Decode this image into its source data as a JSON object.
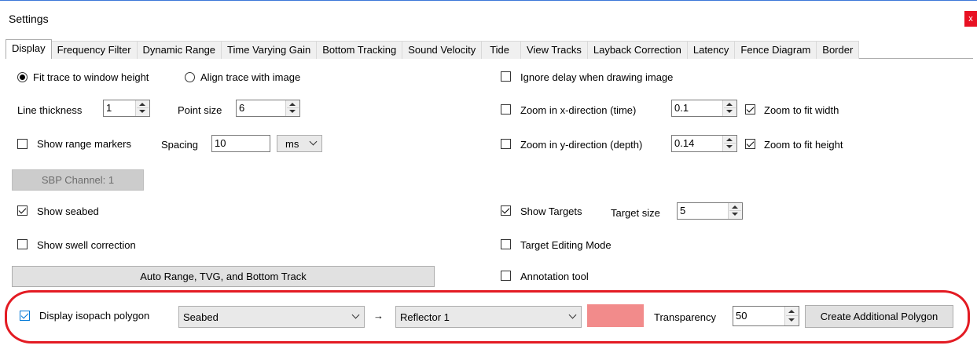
{
  "window": {
    "title": "Settings",
    "close_label": "x"
  },
  "tabs": [
    {
      "label": "Display",
      "active": true
    },
    {
      "label": "Frequency Filter"
    },
    {
      "label": "Dynamic Range"
    },
    {
      "label": "Time Varying Gain"
    },
    {
      "label": "Bottom Tracking"
    },
    {
      "label": "Sound Velocity"
    },
    {
      "label": "Tide"
    },
    {
      "label": "View Tracks"
    },
    {
      "label": "Layback Correction"
    },
    {
      "label": "Latency"
    },
    {
      "label": "Fence Diagram"
    },
    {
      "label": "Border"
    }
  ],
  "left": {
    "fit_trace_label": "Fit trace to window height",
    "fit_trace_selected": true,
    "align_trace_label": "Align trace with image",
    "align_trace_selected": false,
    "line_thickness_label": "Line thickness",
    "line_thickness_value": "1",
    "point_size_label": "Point size",
    "point_size_value": "6",
    "show_range_markers_label": "Show range markers",
    "show_range_markers_checked": false,
    "spacing_label": "Spacing",
    "spacing_value": "10",
    "spacing_unit": "ms",
    "sbp_channel_label": "SBP Channel: 1",
    "show_seabed_label": "Show seabed",
    "show_seabed_checked": true,
    "show_swell_label": "Show swell correction",
    "show_swell_checked": false,
    "auto_range_label": "Auto Range, TVG, and Bottom Track"
  },
  "right": {
    "ignore_delay_label": "Ignore delay when drawing image",
    "ignore_delay_checked": false,
    "zoom_x_label": "Zoom in x-direction (time)",
    "zoom_x_checked": false,
    "zoom_x_value": "0.1",
    "zoom_fit_width_label": "Zoom to fit width",
    "zoom_fit_width_checked": true,
    "zoom_y_label": "Zoom in y-direction (depth)",
    "zoom_y_checked": false,
    "zoom_y_value": "0.14",
    "zoom_fit_height_label": "Zoom to fit height",
    "zoom_fit_height_checked": true,
    "show_targets_label": "Show Targets",
    "show_targets_checked": true,
    "target_size_label": "Target size",
    "target_size_value": "5",
    "target_editing_label": "Target Editing Mode",
    "target_editing_checked": false,
    "annotation_label": "Annotation tool",
    "annotation_checked": false
  },
  "isopach": {
    "display_label": "Display isopach polygon",
    "display_checked": true,
    "from_value": "Seabed",
    "arrow": "→",
    "to_value": "Reflector 1",
    "polygon_color": "#f28b8b",
    "transparency_label": "Transparency",
    "transparency_value": "50",
    "create_button_label": "Create Additional Polygon"
  },
  "colors": {
    "highlight_outline": "#e31b23",
    "accent": "#0078d7"
  }
}
